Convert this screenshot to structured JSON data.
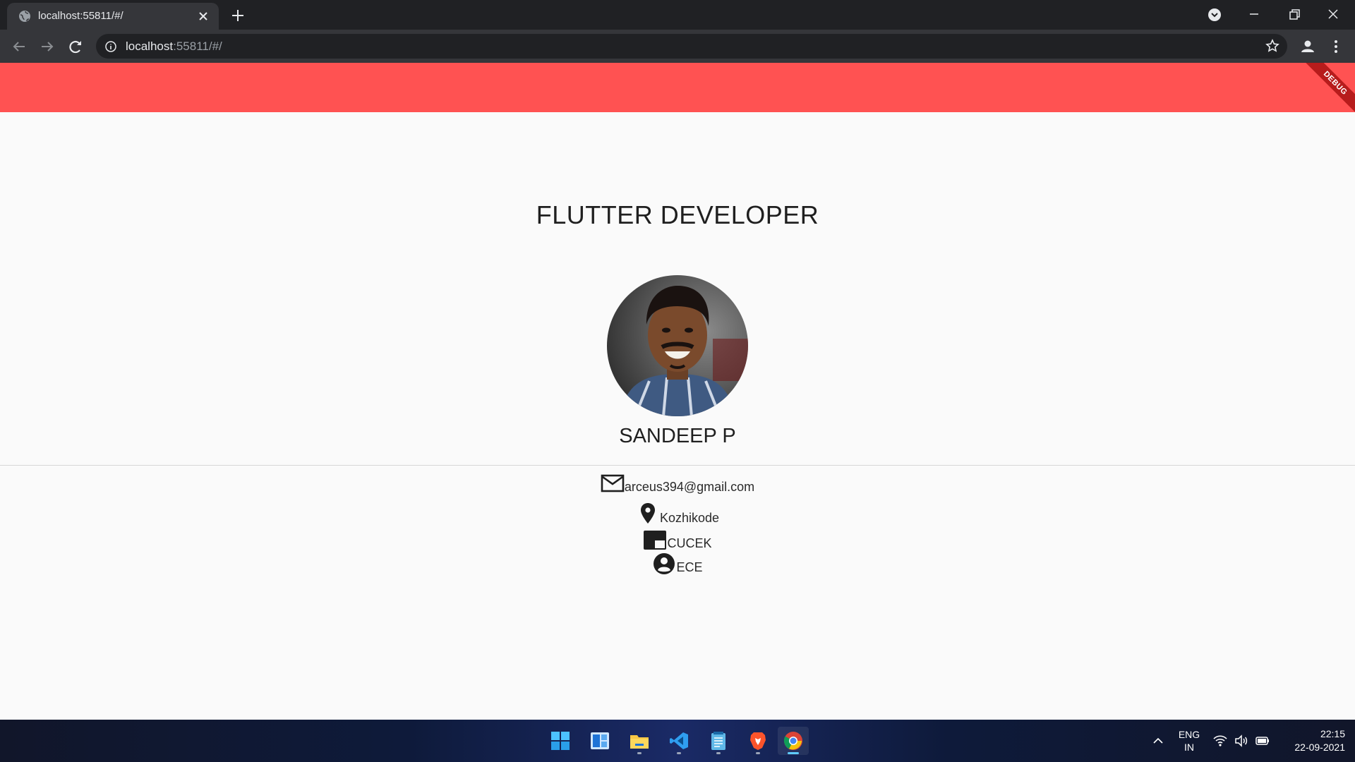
{
  "browser": {
    "tab_title": "localhost:55811/#/",
    "url_host": "localhost",
    "url_rest": ":55811/#/"
  },
  "app": {
    "appbar_color": "#ff5252",
    "debug_label": "DEBUG",
    "headline": "FLUTTER DEVELOPER",
    "name": "SANDEEP P",
    "details": {
      "email": "arceus394@gmail.com",
      "location": "Kozhikode",
      "college": "CUCEK",
      "department": "ECE"
    }
  },
  "taskbar": {
    "apps": [
      "start-icon",
      "widgets-icon",
      "file-explorer-icon",
      "vscode-icon",
      "notepad-icon",
      "brave-icon",
      "chrome-icon"
    ],
    "language_line1": "ENG",
    "language_line2": "IN",
    "time": "22:15",
    "date": "22-09-2021"
  }
}
